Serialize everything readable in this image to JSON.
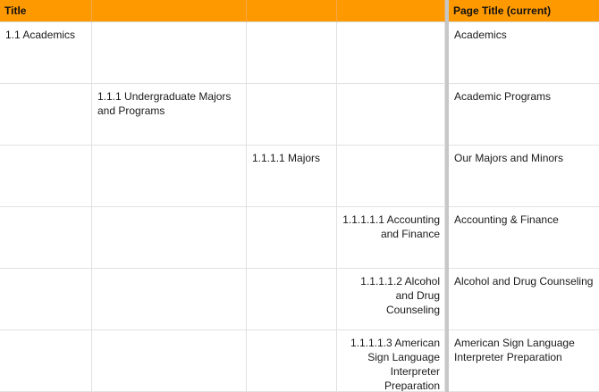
{
  "header": {
    "col1": "Title",
    "col6": "Page Title (current)"
  },
  "rows": [
    {
      "level1": "1.1 Academics",
      "page_title": "Academics"
    },
    {
      "level2": "1.1.1 Undergraduate Majors and Programs",
      "page_title": "Academic Programs"
    },
    {
      "level3": "1.1.1.1 Majors",
      "page_title": "Our Majors and Minors"
    },
    {
      "level4": "1.1.1.1.1 Accounting and Finance",
      "page_title": "Accounting & Finance"
    },
    {
      "level4": "1.1.1.1.2 Alcohol and Drug Counseling",
      "page_title": "Alcohol and Drug Counseling"
    },
    {
      "level4": "1.1.1.1.3 American Sign Language Interpreter Preparation",
      "page_title": "American Sign Language Interpreter Preparation"
    }
  ],
  "colors": {
    "header_bg": "#ff9900",
    "gridline": "#e2e2e2",
    "freeze_bar": "#c7c7c7"
  }
}
